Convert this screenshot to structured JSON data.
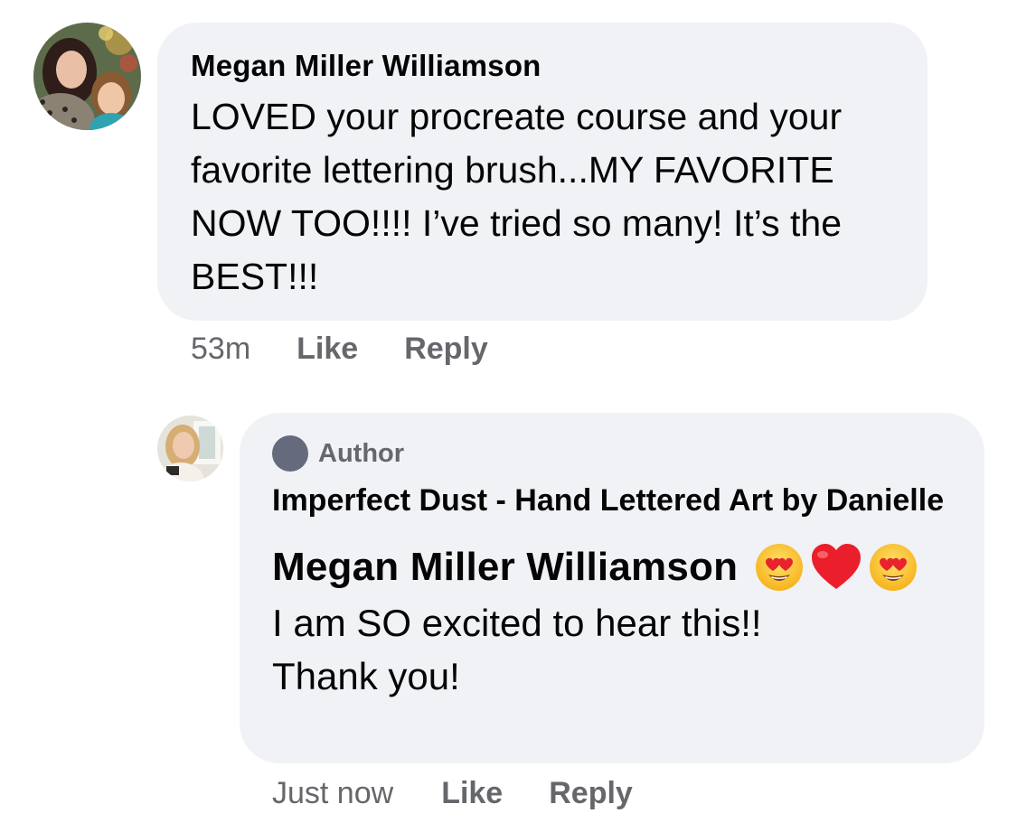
{
  "comment": {
    "author": "Megan Miller Williamson",
    "text": "LOVED your procreate course and your favorite lettering brush...MY FAVORITE NOW TOO!!!! I’ve tried so many! It’s the BEST!!!",
    "timestamp": "53m",
    "like_label": "Like",
    "reply_label": "Reply"
  },
  "reply": {
    "badge_label": "Author",
    "author": "Imperfect Dust - Hand Lettered Art by Danielle",
    "mention": "Megan Miller Williamson",
    "emojis": [
      "heart-eyes-emoji",
      "red-heart-emoji",
      "heart-eyes-emoji"
    ],
    "text_line1": "I am SO excited to hear this!!",
    "text_line2": "Thank you!",
    "timestamp": "Just now",
    "like_label": "Like",
    "reply_label": "Reply"
  },
  "colors": {
    "bubble_background": "#f0f2f5",
    "secondary_text": "#65676b",
    "primary_text": "#050505",
    "author_badge": "#656b7c"
  }
}
